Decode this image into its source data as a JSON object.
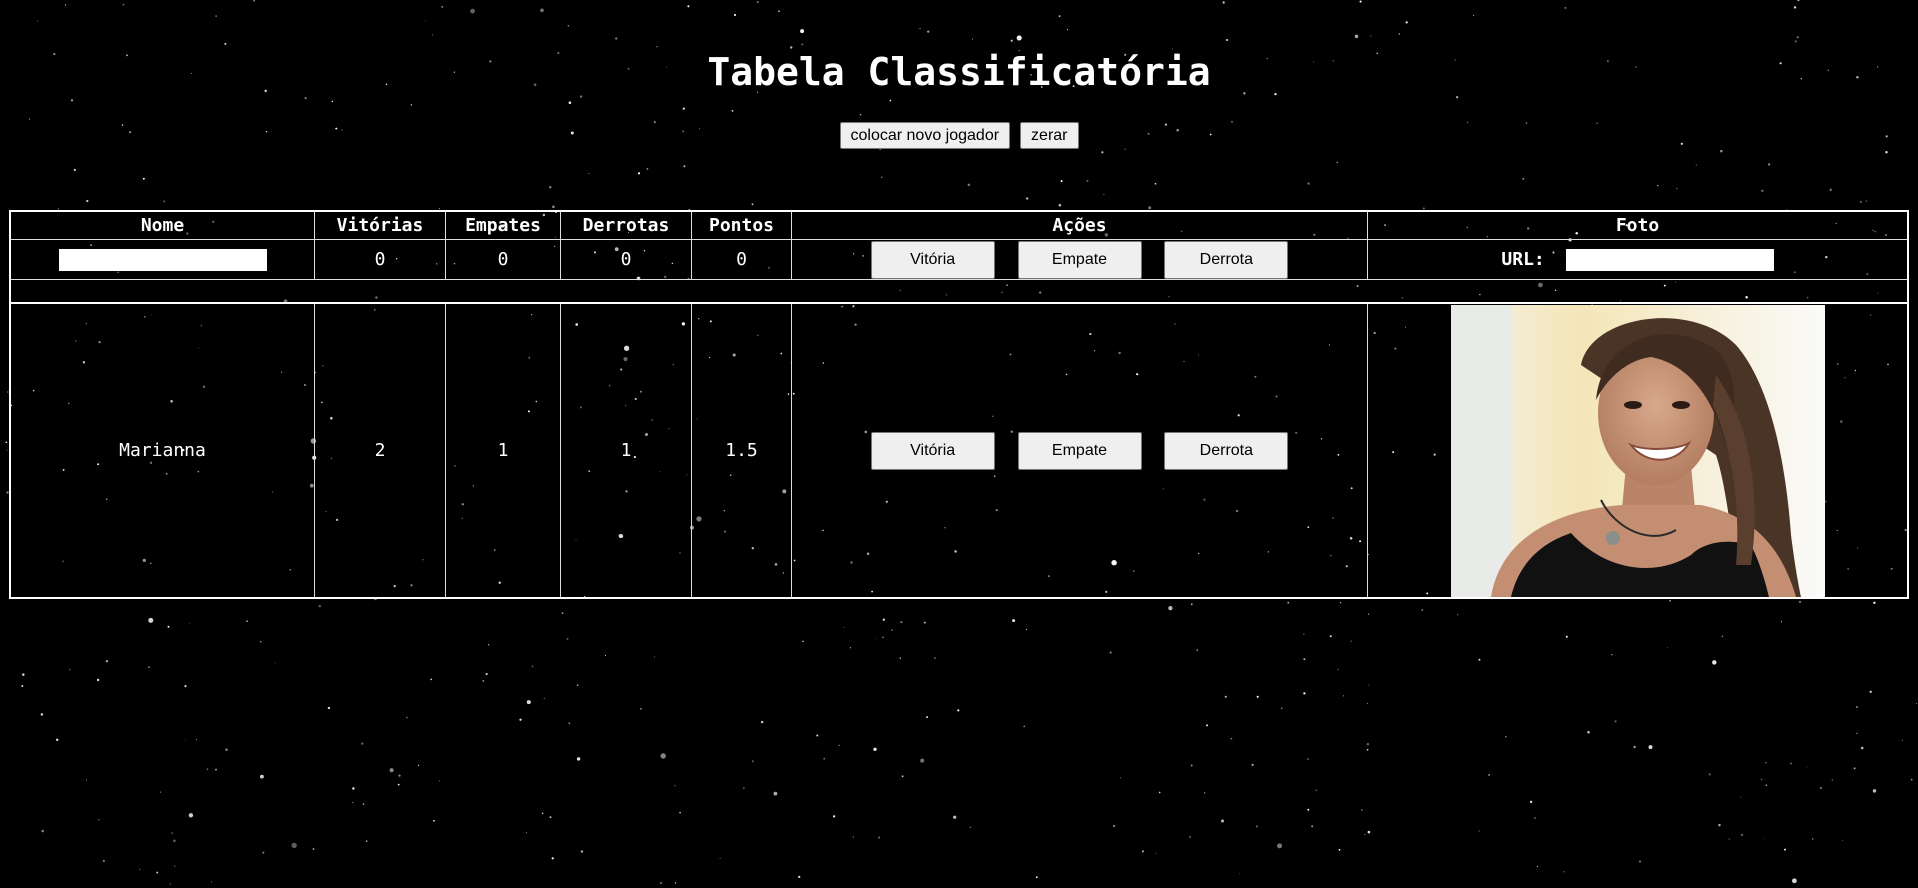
{
  "page": {
    "title": "Tabela Classificatória",
    "buttons": {
      "add_player": "colocar novo jogador",
      "reset": "zerar"
    }
  },
  "table": {
    "headers": [
      "Nome",
      "Vitórias",
      "Empates",
      "Derrotas",
      "Pontos",
      "Ações",
      "Foto"
    ],
    "entry_row": {
      "name_value": "",
      "wins": "0",
      "draws": "0",
      "losses": "0",
      "points": "0",
      "actions": [
        "Vitória",
        "Empate",
        "Derrota"
      ],
      "url_label": "URL:",
      "url_value": ""
    },
    "players": [
      {
        "name": "Marianna",
        "wins": "2",
        "draws": "1",
        "losses": "1",
        "points": "1.5",
        "actions": [
          "Vitória",
          "Empate",
          "Derrota"
        ]
      }
    ]
  },
  "colors": {
    "background": "#000000",
    "text": "#ffffff",
    "button_bg": "#efefef"
  }
}
